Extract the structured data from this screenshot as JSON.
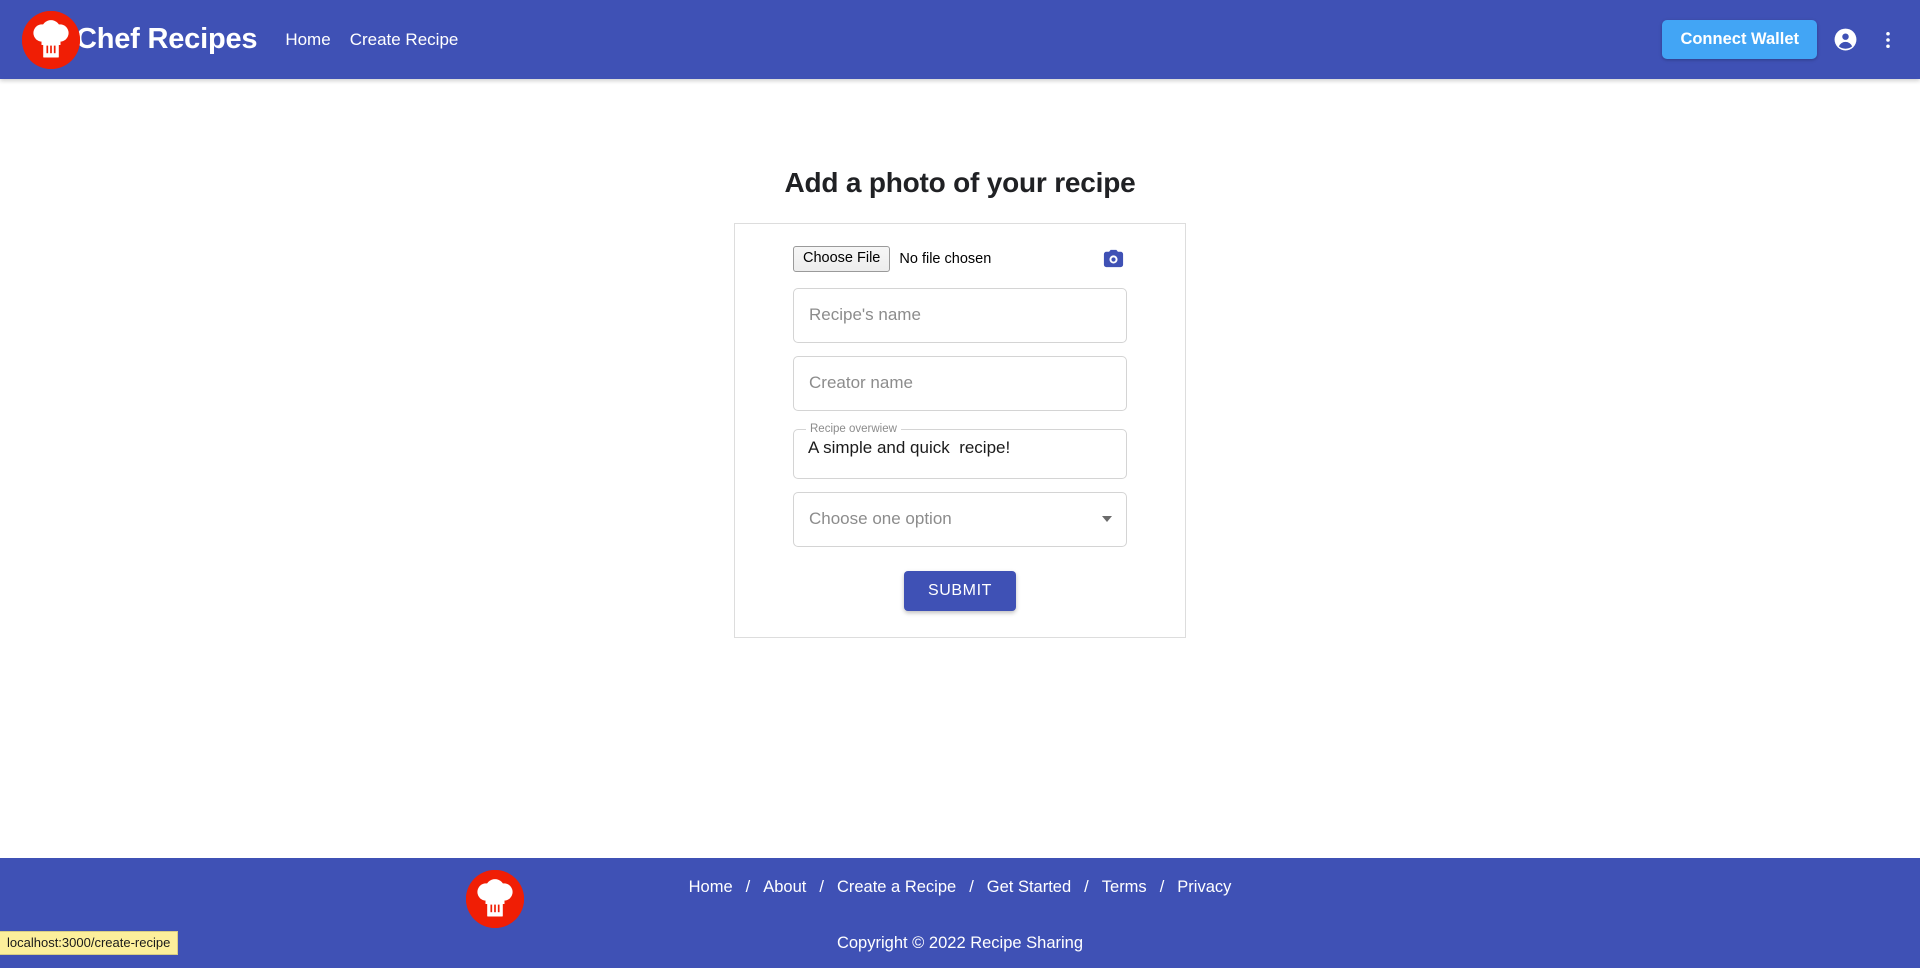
{
  "navbar": {
    "logo_icon": "chef-hat-logo-icon",
    "brand_name": "Chef Recipes",
    "links": [
      {
        "label": "Home"
      },
      {
        "label": "Create Recipe"
      }
    ],
    "connect_wallet_label": "Connect Wallet",
    "account_icon": "account-circle-icon",
    "menu_icon": "more-vertical-icon",
    "background_color": "#3F51B5",
    "wallet_button_color": "#42A5F5",
    "logo_color": "#F01E05"
  },
  "main": {
    "title": "Add a photo of your recipe",
    "file_input": {
      "button_label": "Choose File",
      "status_text": "No file chosen",
      "camera_icon": "camera-icon",
      "camera_icon_color": "#3F51B5"
    },
    "fields": {
      "recipe_name_placeholder": "Recipe's name",
      "recipe_name_value": "",
      "creator_name_placeholder": "Creator name",
      "creator_name_value": "",
      "overview_label": "Recipe overwiew",
      "overview_value": "A simple and quick  recipe!",
      "select_label": "Choose one option",
      "select_arrow_icon": "chevron-down-icon"
    },
    "submit_label": "SUBMIT",
    "submit_color": "#3F51B5"
  },
  "footer": {
    "logo_icon": "chef-hat-logo-icon",
    "separator": "/",
    "links": [
      {
        "label": "Home"
      },
      {
        "label": "About"
      },
      {
        "label": "Create a Recipe"
      },
      {
        "label": "Get Started"
      },
      {
        "label": "Terms"
      },
      {
        "label": "Privacy"
      }
    ],
    "copyright": "Copyright © 2022 Recipe Sharing",
    "background_color": "#3F51B5"
  },
  "status_bar": {
    "url": "localhost:3000/create-recipe"
  }
}
